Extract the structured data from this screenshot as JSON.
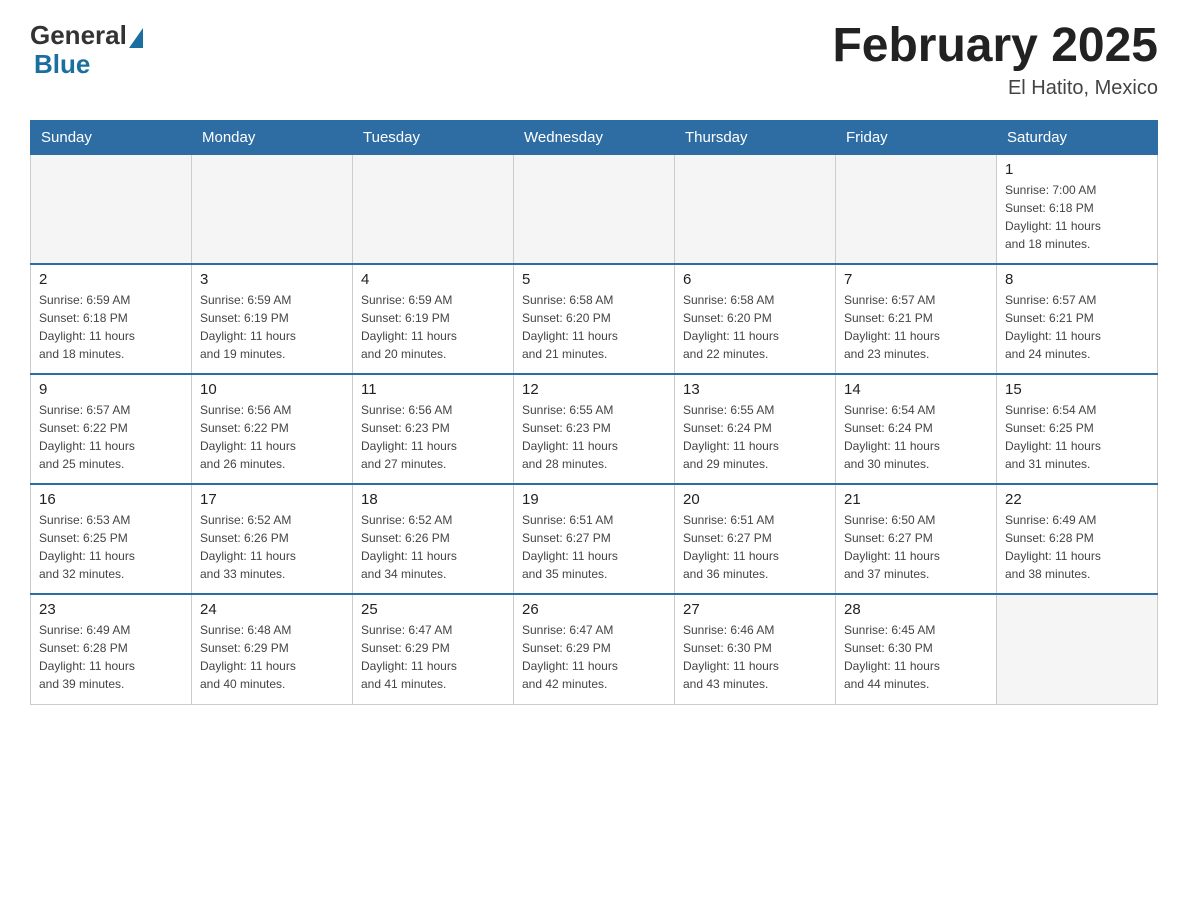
{
  "header": {
    "logo_general": "General",
    "logo_blue": "Blue",
    "main_title": "February 2025",
    "subtitle": "El Hatito, Mexico"
  },
  "days_of_week": [
    "Sunday",
    "Monday",
    "Tuesday",
    "Wednesday",
    "Thursday",
    "Friday",
    "Saturday"
  ],
  "weeks": [
    [
      {
        "day": "",
        "info": ""
      },
      {
        "day": "",
        "info": ""
      },
      {
        "day": "",
        "info": ""
      },
      {
        "day": "",
        "info": ""
      },
      {
        "day": "",
        "info": ""
      },
      {
        "day": "",
        "info": ""
      },
      {
        "day": "1",
        "info": "Sunrise: 7:00 AM\nSunset: 6:18 PM\nDaylight: 11 hours\nand 18 minutes."
      }
    ],
    [
      {
        "day": "2",
        "info": "Sunrise: 6:59 AM\nSunset: 6:18 PM\nDaylight: 11 hours\nand 18 minutes."
      },
      {
        "day": "3",
        "info": "Sunrise: 6:59 AM\nSunset: 6:19 PM\nDaylight: 11 hours\nand 19 minutes."
      },
      {
        "day": "4",
        "info": "Sunrise: 6:59 AM\nSunset: 6:19 PM\nDaylight: 11 hours\nand 20 minutes."
      },
      {
        "day": "5",
        "info": "Sunrise: 6:58 AM\nSunset: 6:20 PM\nDaylight: 11 hours\nand 21 minutes."
      },
      {
        "day": "6",
        "info": "Sunrise: 6:58 AM\nSunset: 6:20 PM\nDaylight: 11 hours\nand 22 minutes."
      },
      {
        "day": "7",
        "info": "Sunrise: 6:57 AM\nSunset: 6:21 PM\nDaylight: 11 hours\nand 23 minutes."
      },
      {
        "day": "8",
        "info": "Sunrise: 6:57 AM\nSunset: 6:21 PM\nDaylight: 11 hours\nand 24 minutes."
      }
    ],
    [
      {
        "day": "9",
        "info": "Sunrise: 6:57 AM\nSunset: 6:22 PM\nDaylight: 11 hours\nand 25 minutes."
      },
      {
        "day": "10",
        "info": "Sunrise: 6:56 AM\nSunset: 6:22 PM\nDaylight: 11 hours\nand 26 minutes."
      },
      {
        "day": "11",
        "info": "Sunrise: 6:56 AM\nSunset: 6:23 PM\nDaylight: 11 hours\nand 27 minutes."
      },
      {
        "day": "12",
        "info": "Sunrise: 6:55 AM\nSunset: 6:23 PM\nDaylight: 11 hours\nand 28 minutes."
      },
      {
        "day": "13",
        "info": "Sunrise: 6:55 AM\nSunset: 6:24 PM\nDaylight: 11 hours\nand 29 minutes."
      },
      {
        "day": "14",
        "info": "Sunrise: 6:54 AM\nSunset: 6:24 PM\nDaylight: 11 hours\nand 30 minutes."
      },
      {
        "day": "15",
        "info": "Sunrise: 6:54 AM\nSunset: 6:25 PM\nDaylight: 11 hours\nand 31 minutes."
      }
    ],
    [
      {
        "day": "16",
        "info": "Sunrise: 6:53 AM\nSunset: 6:25 PM\nDaylight: 11 hours\nand 32 minutes."
      },
      {
        "day": "17",
        "info": "Sunrise: 6:52 AM\nSunset: 6:26 PM\nDaylight: 11 hours\nand 33 minutes."
      },
      {
        "day": "18",
        "info": "Sunrise: 6:52 AM\nSunset: 6:26 PM\nDaylight: 11 hours\nand 34 minutes."
      },
      {
        "day": "19",
        "info": "Sunrise: 6:51 AM\nSunset: 6:27 PM\nDaylight: 11 hours\nand 35 minutes."
      },
      {
        "day": "20",
        "info": "Sunrise: 6:51 AM\nSunset: 6:27 PM\nDaylight: 11 hours\nand 36 minutes."
      },
      {
        "day": "21",
        "info": "Sunrise: 6:50 AM\nSunset: 6:27 PM\nDaylight: 11 hours\nand 37 minutes."
      },
      {
        "day": "22",
        "info": "Sunrise: 6:49 AM\nSunset: 6:28 PM\nDaylight: 11 hours\nand 38 minutes."
      }
    ],
    [
      {
        "day": "23",
        "info": "Sunrise: 6:49 AM\nSunset: 6:28 PM\nDaylight: 11 hours\nand 39 minutes."
      },
      {
        "day": "24",
        "info": "Sunrise: 6:48 AM\nSunset: 6:29 PM\nDaylight: 11 hours\nand 40 minutes."
      },
      {
        "day": "25",
        "info": "Sunrise: 6:47 AM\nSunset: 6:29 PM\nDaylight: 11 hours\nand 41 minutes."
      },
      {
        "day": "26",
        "info": "Sunrise: 6:47 AM\nSunset: 6:29 PM\nDaylight: 11 hours\nand 42 minutes."
      },
      {
        "day": "27",
        "info": "Sunrise: 6:46 AM\nSunset: 6:30 PM\nDaylight: 11 hours\nand 43 minutes."
      },
      {
        "day": "28",
        "info": "Sunrise: 6:45 AM\nSunset: 6:30 PM\nDaylight: 11 hours\nand 44 minutes."
      },
      {
        "day": "",
        "info": ""
      }
    ]
  ]
}
